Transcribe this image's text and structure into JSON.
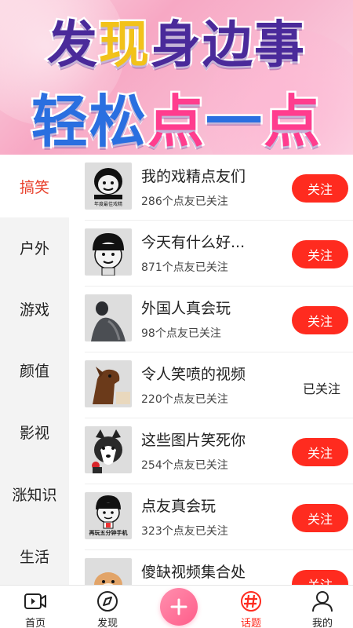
{
  "banner": {
    "line1": [
      {
        "text": "发",
        "hl": false
      },
      {
        "text": "现",
        "hl": true
      },
      {
        "text": "身边事",
        "hl": false
      }
    ],
    "line2": [
      {
        "text": "轻松",
        "hl": false
      },
      {
        "text": "点",
        "hl": true
      },
      {
        "text": "一",
        "hl": false
      },
      {
        "text": "点",
        "hl": true
      }
    ]
  },
  "sidebar": {
    "items": [
      {
        "label": "搞笑",
        "active": true
      },
      {
        "label": "户外",
        "active": false
      },
      {
        "label": "游戏",
        "active": false
      },
      {
        "label": "颜值",
        "active": false
      },
      {
        "label": "影视",
        "active": false
      },
      {
        "label": "涨知识",
        "active": false
      },
      {
        "label": "生活",
        "active": false
      }
    ]
  },
  "topics": [
    {
      "title": "我的戏精点友们",
      "count": "286个点友已关注",
      "followed": false,
      "thumb": "meme-face-icon",
      "thumb_caption": "年度最佳戏精"
    },
    {
      "title": "今天有什么好...",
      "count": "871个点友已关注",
      "followed": false,
      "thumb": "meme-bowl-cut-icon"
    },
    {
      "title": "外国人真会玩",
      "count": "98个点友已关注",
      "followed": false,
      "thumb": "photo-dark-icon"
    },
    {
      "title": "令人笑喷的视频",
      "count": "220个点友已关注",
      "followed": true,
      "thumb": "horse-photo-icon"
    },
    {
      "title": "这些图片笑死你",
      "count": "254个点友已关注",
      "followed": false,
      "thumb": "husky-photo-icon"
    },
    {
      "title": "点友真会玩",
      "count": "323个点友已关注",
      "followed": false,
      "thumb": "meme-phone-icon",
      "thumb_caption": "再玩五分钟手机"
    },
    {
      "title": "傻缺视频集合处",
      "count": "",
      "followed": false,
      "thumb": "shiba-photo-icon"
    }
  ],
  "labels": {
    "follow": "关注",
    "followed": "已关注"
  },
  "tabbar": {
    "items": [
      {
        "label": "首页",
        "icon": "video-icon",
        "active": false
      },
      {
        "label": "发现",
        "icon": "compass-icon",
        "active": false
      },
      {
        "label": "",
        "icon": "plus-icon",
        "active": false
      },
      {
        "label": "话题",
        "icon": "hashtag-icon",
        "active": true
      },
      {
        "label": "我的",
        "icon": "user-icon",
        "active": false
      }
    ]
  },
  "colors": {
    "accent": "#ff2b1f",
    "active_category": "#e8412c",
    "plus": "#ff5d8a"
  }
}
